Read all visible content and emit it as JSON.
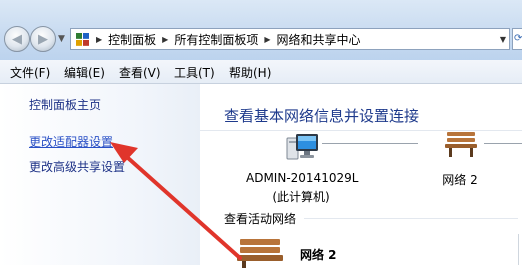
{
  "address_bar": {
    "breadcrumbs": [
      "控制面板",
      "所有控制面板项",
      "网络和共享中心"
    ]
  },
  "menu": {
    "items": [
      "文件(F)",
      "编辑(E)",
      "查看(V)",
      "工具(T)",
      "帮助(H)"
    ]
  },
  "sidebar": {
    "links": [
      "控制面板主页",
      "更改适配器设置",
      "更改高级共享设置"
    ]
  },
  "main": {
    "title": "查看基本网络信息并设置连接",
    "computer_name": "ADMIN-20141029L",
    "computer_sub": "(此计算机)",
    "network_label": "网络  2",
    "active_networks_label": "查看活动网络",
    "active_network_name": "网络  2"
  },
  "colors": {
    "link": "#1e3287",
    "heading": "#1e3a8c",
    "annotation": "#e0352b"
  }
}
